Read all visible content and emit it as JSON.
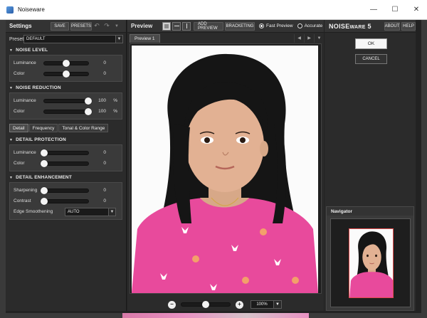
{
  "window": {
    "title": "Noiseware"
  },
  "settings": {
    "title": "Settings",
    "save_label": "SAVE",
    "presets_label": "PRESETS",
    "preset_label": "Preset",
    "preset_value": "DEFAULT"
  },
  "noise_level": {
    "title": "NOISE LEVEL",
    "rows": [
      {
        "label": "Luminance",
        "value": "0",
        "unit": "",
        "fraction": 0.5
      },
      {
        "label": "Color",
        "value": "0",
        "unit": "",
        "fraction": 0.5
      }
    ]
  },
  "noise_reduction": {
    "title": "NOISE REDUCTION",
    "rows": [
      {
        "label": "Luminance",
        "value": "100",
        "unit": "%",
        "fraction": 1.0
      },
      {
        "label": "Color",
        "value": "100",
        "unit": "%",
        "fraction": 1.0
      }
    ]
  },
  "tabs": [
    "Detail",
    "Frequency",
    "Tonal & Color Range"
  ],
  "detail_protection": {
    "title": "DETAIL PROTECTION",
    "rows": [
      {
        "label": "Luminance",
        "value": "0",
        "unit": "",
        "fraction": 0.0
      },
      {
        "label": "Color",
        "value": "0",
        "unit": "",
        "fraction": 0.0
      }
    ]
  },
  "detail_enhancement": {
    "title": "DETAIL ENHANCEMENT",
    "rows": [
      {
        "label": "Sharpening",
        "value": "0",
        "unit": "",
        "fraction": 0.0
      },
      {
        "label": "Contrast",
        "value": "0",
        "unit": "",
        "fraction": 0.0
      }
    ],
    "edge_label": "Edge Smoothening",
    "edge_value": "AUTO"
  },
  "preview": {
    "title": "Preview",
    "add_preview_label": "ADD PREVIEW",
    "bracketing_label": "BRACKETING",
    "fast_preview_label": "Fast Preview",
    "accurate_label": "Accurate",
    "tab_label": "Preview 1",
    "zoom_value": "100%",
    "zoom_fraction": 0.5
  },
  "right": {
    "brand_main": "NOISE",
    "brand_rest": "WARE",
    "brand_ver": "5",
    "about_label": "ABOUT",
    "help_label": "HELP",
    "ok_label": "OK",
    "cancel_label": "CANCEL",
    "navigator_title": "Navigator"
  }
}
